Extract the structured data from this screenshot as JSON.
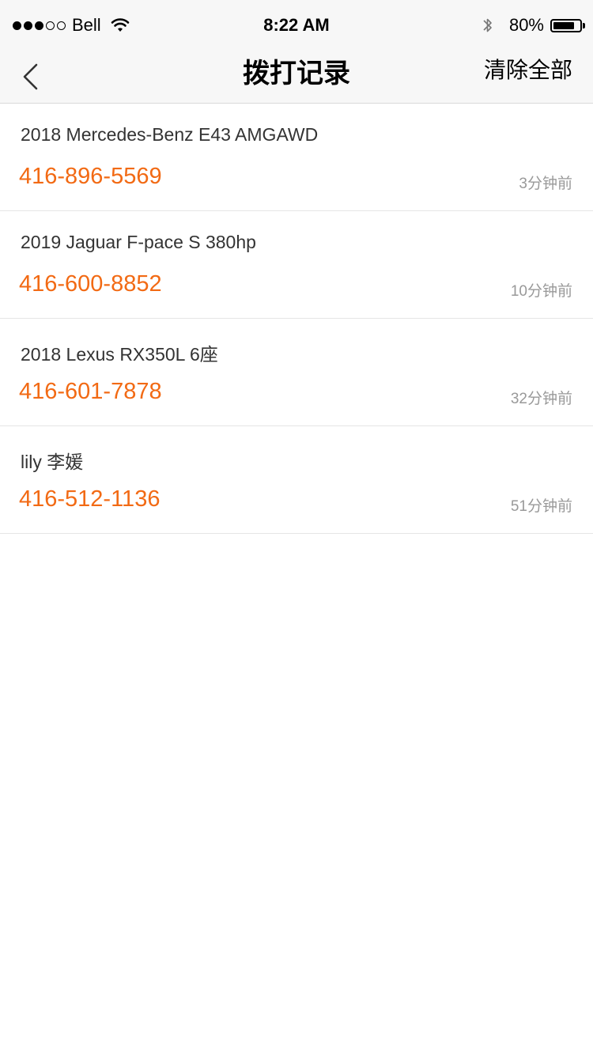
{
  "status_bar": {
    "signal_filled": 3,
    "signal_total": 5,
    "carrier": "Bell",
    "time": "8:22 AM",
    "battery_text": "80%",
    "battery_level": 0.8
  },
  "nav": {
    "title": "拨打记录",
    "clear_all": "清除全部"
  },
  "calls": [
    {
      "name": "2018 Mercedes-Benz E43 AMGAWD",
      "phone": "416-896-5569",
      "time": "3分钟前"
    },
    {
      "name": "2019 Jaguar F-pace S 380hp",
      "phone": "416-600-8852",
      "time": "10分钟前"
    },
    {
      "name": "2018 Lexus RX350L 6座",
      "phone": "416-601-7878",
      "time": "32分钟前"
    },
    {
      "name": "lily 李媛",
      "phone": "416-512-1136",
      "time": "51分钟前"
    }
  ],
  "colors": {
    "phone": "#f26a14",
    "nav_bg": "#f7f7f7",
    "timestamp": "#999999"
  }
}
